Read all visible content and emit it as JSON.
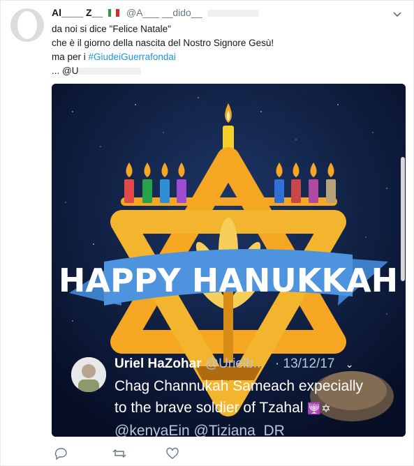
{
  "tweet": {
    "author_name": "Al____ Z__",
    "author_handle": "@A___ __dido__",
    "text_lines": [
      "da noi si dice \"Felice Natale\"",
      "che è il giorno della nascita del Nostro Signore Gesù!"
    ],
    "line3_prefix": "ma per i ",
    "hashtag": "#GiudeiGuerrafondai",
    "line4": "... @U"
  },
  "image": {
    "banner_text": "HAPPY HANUKKAH",
    "candle_colors": [
      "#e24a4a",
      "#27a14a",
      "#2f8fd6",
      "#a04bd3",
      "#2f6fd6",
      "#c94747",
      "#b04aa0",
      "#b7a37a"
    ],
    "star_color": "#f5a623",
    "banner_color": "#4d93dd",
    "reply": {
      "name": "Uriel HaZohar",
      "handle": "@Urielb...",
      "date": "· 13/12/17",
      "text_line1": "Chag Channukah Sameach expecially",
      "text_line2": "to the brave soldier of Tzahal",
      "emojis": "🕎✡",
      "mentions": "@kenyaEin @Tiziana_DR"
    }
  },
  "actions": [
    "reply-icon",
    "retweet-icon",
    "like-icon"
  ]
}
